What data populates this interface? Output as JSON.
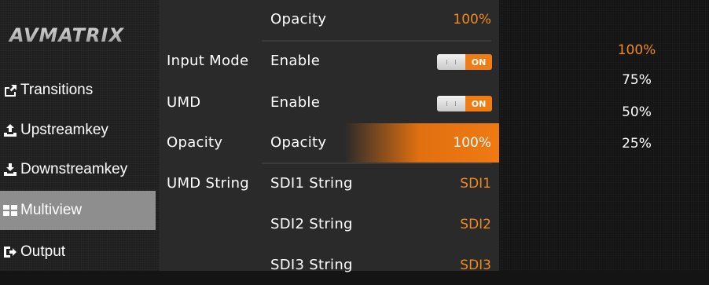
{
  "brand": {
    "logo_text": "AVMATRIX"
  },
  "sidebar": {
    "items": [
      {
        "label": "Transitions",
        "icon": "share-icon",
        "active": false
      },
      {
        "label": "Upstreamkey",
        "icon": "upload-icon",
        "active": false
      },
      {
        "label": "Downstreamkey",
        "icon": "download-icon",
        "active": false
      },
      {
        "label": "Multiview",
        "icon": "grid-icon",
        "active": true
      },
      {
        "label": "Output",
        "icon": "output-icon",
        "active": false
      }
    ]
  },
  "panel": {
    "rows": [
      {
        "category": "",
        "item": "Opacity",
        "value": "100%"
      },
      {
        "category": "Input Mode",
        "item": "Enable",
        "toggle": "ON"
      },
      {
        "category": "UMD",
        "item": "Enable",
        "toggle": "ON"
      },
      {
        "category": "Opacity",
        "item": "Opacity",
        "value": "100%",
        "selected": true
      },
      {
        "category": "UMD String",
        "item": "SDI1 String",
        "value": "SDI1"
      },
      {
        "category": "",
        "item": "SDI2 String",
        "value": "SDI2"
      },
      {
        "category": "",
        "item": "SDI3 String",
        "value": "SDI3"
      }
    ]
  },
  "options": {
    "items": [
      "100%",
      "75%",
      "50%",
      "25%"
    ],
    "selected": "100%"
  },
  "colors": {
    "accent": "#f08a1e",
    "active_bg": "#8e8e8e"
  }
}
